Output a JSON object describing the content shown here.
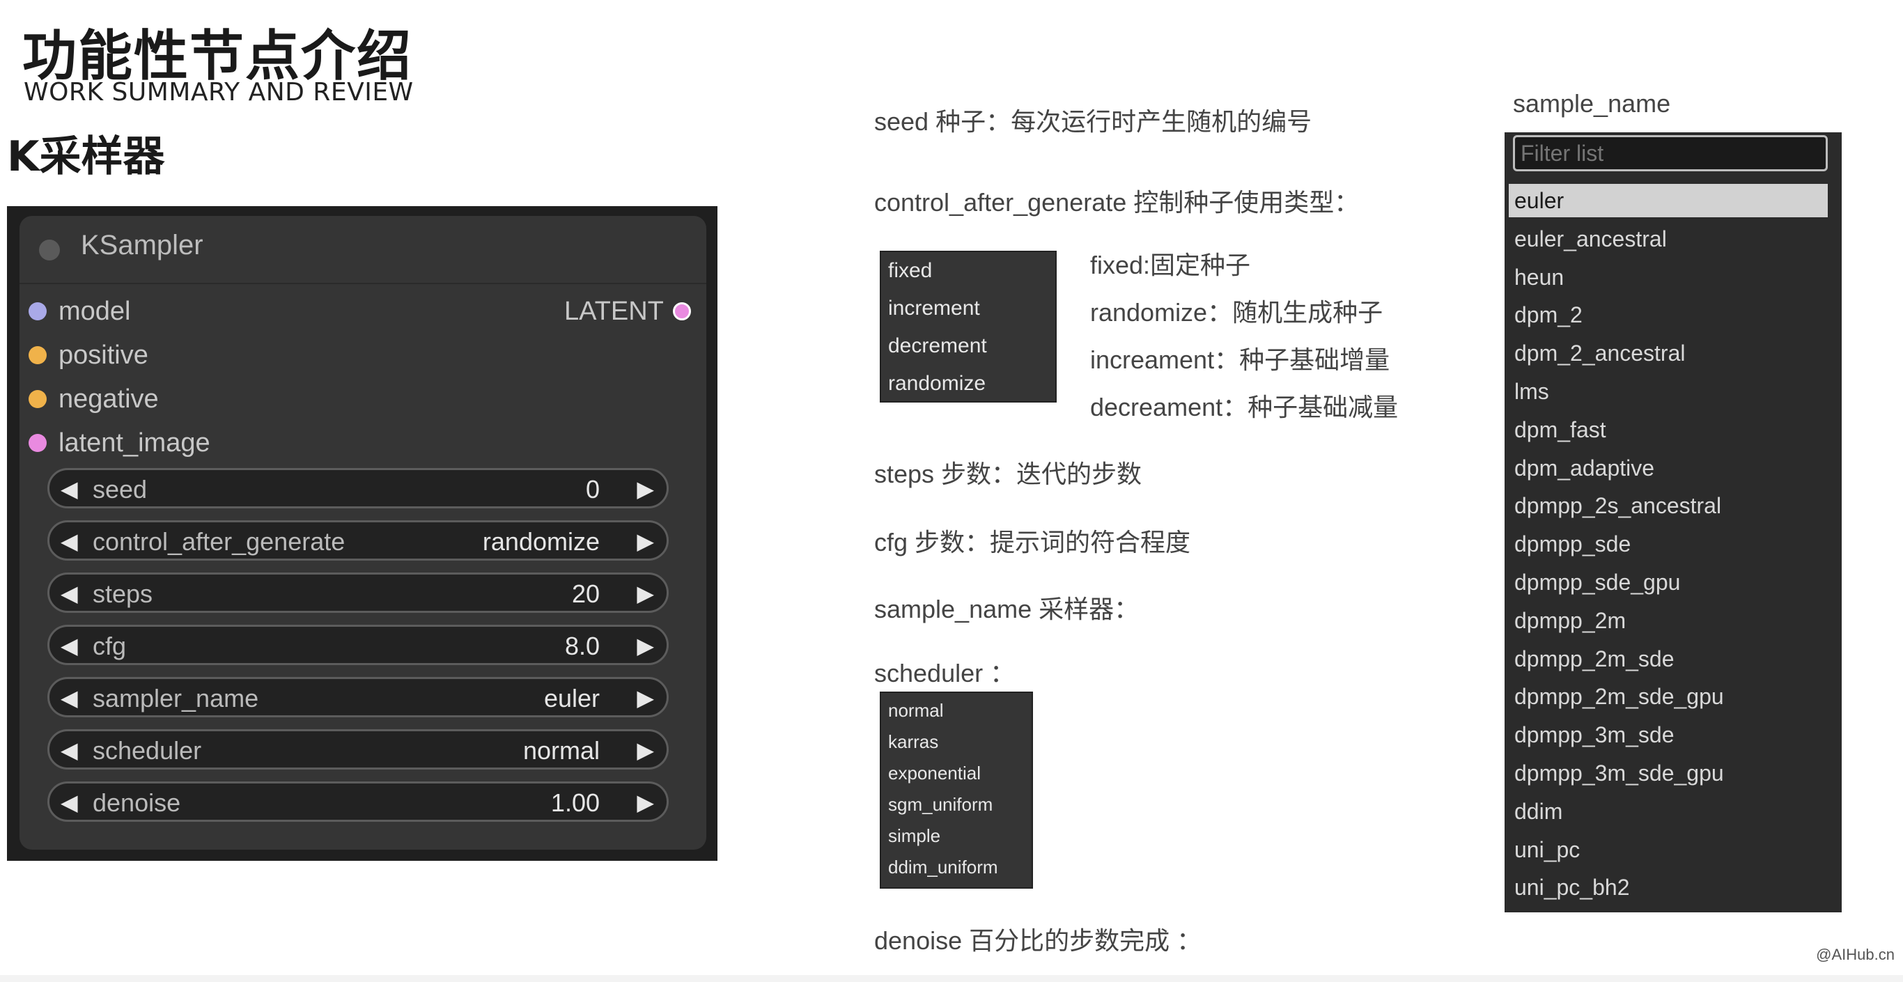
{
  "header": {
    "title": "功能性节点介绍",
    "subtitle": "WORK SUMMARY AND REVIEW",
    "section_title": "K采样器"
  },
  "ksampler": {
    "title": "KSampler",
    "inputs": [
      "model",
      "positive",
      "negative",
      "latent_image"
    ],
    "input_colors": [
      "#a9a9e8",
      "#f0b24a",
      "#f0b24a",
      "#e98ae0"
    ],
    "output": "LATENT",
    "output_color": "#e98ae0",
    "widgets": [
      {
        "name": "seed",
        "value": "0"
      },
      {
        "name": "control_after_generate",
        "value": "randomize"
      },
      {
        "name": "steps",
        "value": "20"
      },
      {
        "name": "cfg",
        "value": "8.0"
      },
      {
        "name": "sampler_name",
        "value": "euler"
      },
      {
        "name": "scheduler",
        "value": "normal"
      },
      {
        "name": "denoise",
        "value": "1.00"
      }
    ]
  },
  "descriptions": {
    "seed": "seed 种子：每次运行时产生随机的编号",
    "control": "control_after_generate 控制种子使用类型：",
    "fixed": "fixed:固定种子",
    "randomize": "randomize：随机生成种子",
    "increament": "increament：种子基础增量",
    "decreament": "decreament：种子基础减量",
    "steps": "steps 步数：迭代的步数",
    "cfg": "cfg 步数：提示词的符合程度",
    "sample_name": "sample_name 采样器：",
    "scheduler": "scheduler ：",
    "denoise": "denoise 百分比的步数完成 ："
  },
  "control_options": [
    "fixed",
    "increment",
    "decrement",
    "randomize"
  ],
  "scheduler_options": [
    "normal",
    "karras",
    "exponential",
    "sgm_uniform",
    "simple",
    "ddim_uniform"
  ],
  "sampler_list": {
    "label": "sample_name",
    "filter_placeholder": "Filter list",
    "selected": "euler",
    "items": [
      "euler",
      "euler_ancestral",
      "heun",
      "dpm_2",
      "dpm_2_ancestral",
      "lms",
      "dpm_fast",
      "dpm_adaptive",
      "dpmpp_2s_ancestral",
      "dpmpp_sde",
      "dpmpp_sde_gpu",
      "dpmpp_2m",
      "dpmpp_2m_sde",
      "dpmpp_2m_sde_gpu",
      "dpmpp_3m_sde",
      "dpmpp_3m_sde_gpu",
      "ddim",
      "uni_pc",
      "uni_pc_bh2"
    ]
  },
  "footer": "@AIHub.cn"
}
